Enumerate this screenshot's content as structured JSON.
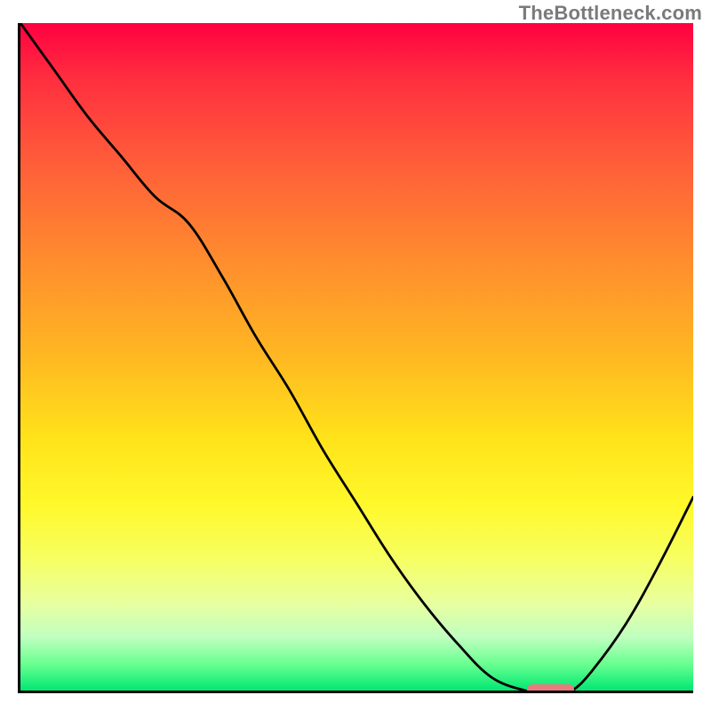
{
  "watermark": "TheBottleneck.com",
  "chart_data": {
    "type": "line",
    "title": "",
    "xlabel": "",
    "ylabel": "",
    "xlim": [
      0,
      100
    ],
    "ylim": [
      0,
      100
    ],
    "grid": false,
    "x": [
      0,
      5,
      10,
      15,
      20,
      25,
      30,
      35,
      40,
      45,
      50,
      55,
      60,
      65,
      70,
      75,
      77,
      80,
      82,
      85,
      90,
      95,
      100
    ],
    "y": [
      100,
      93,
      86,
      80,
      74,
      70,
      62,
      53,
      45,
      36,
      28,
      20,
      13,
      7,
      2,
      0,
      0,
      0,
      0,
      3,
      10,
      19,
      29
    ],
    "marker_segment": {
      "x_start": 75,
      "x_end": 82,
      "y": 0
    },
    "background": "vertical-gradient-red-yellow-green",
    "notes": "Values are approximate readings from the rendered curve against an unlabeled axis; y expressed as percent of plot height from bottom."
  },
  "colors": {
    "axis": "#000000",
    "curve": "#000000",
    "marker": "#e87b80",
    "watermark": "#7a7a7a"
  }
}
